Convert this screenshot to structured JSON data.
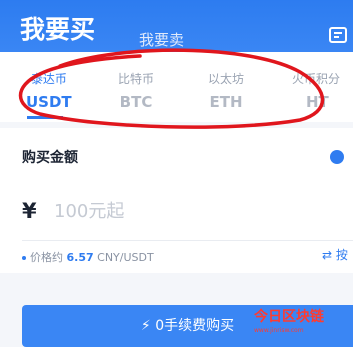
{
  "header": {
    "buy_tab": "我要买",
    "sell_tab": "我要卖"
  },
  "coins": [
    {
      "name": "泰达币",
      "symbol": "USDT",
      "active": true
    },
    {
      "name": "比特币",
      "symbol": "BTC",
      "active": false
    },
    {
      "name": "以太坊",
      "symbol": "ETH",
      "active": false
    },
    {
      "name": "火币积分",
      "symbol": "HT",
      "active": false
    }
  ],
  "card": {
    "title": "购买金额",
    "currency_symbol": "¥",
    "amount_placeholder": "100元起",
    "price_label": "价格约",
    "price_value": "6.57",
    "price_unit": "CNY/USDT",
    "toggle_label": "按"
  },
  "buy_button": "0手续费购买",
  "watermark": {
    "text": "今日区块链",
    "sub": "www.jinrisw.com"
  },
  "colors": {
    "accent": "#2f7cf0",
    "header": "#3a86f4",
    "annotation": "#e0161d"
  }
}
